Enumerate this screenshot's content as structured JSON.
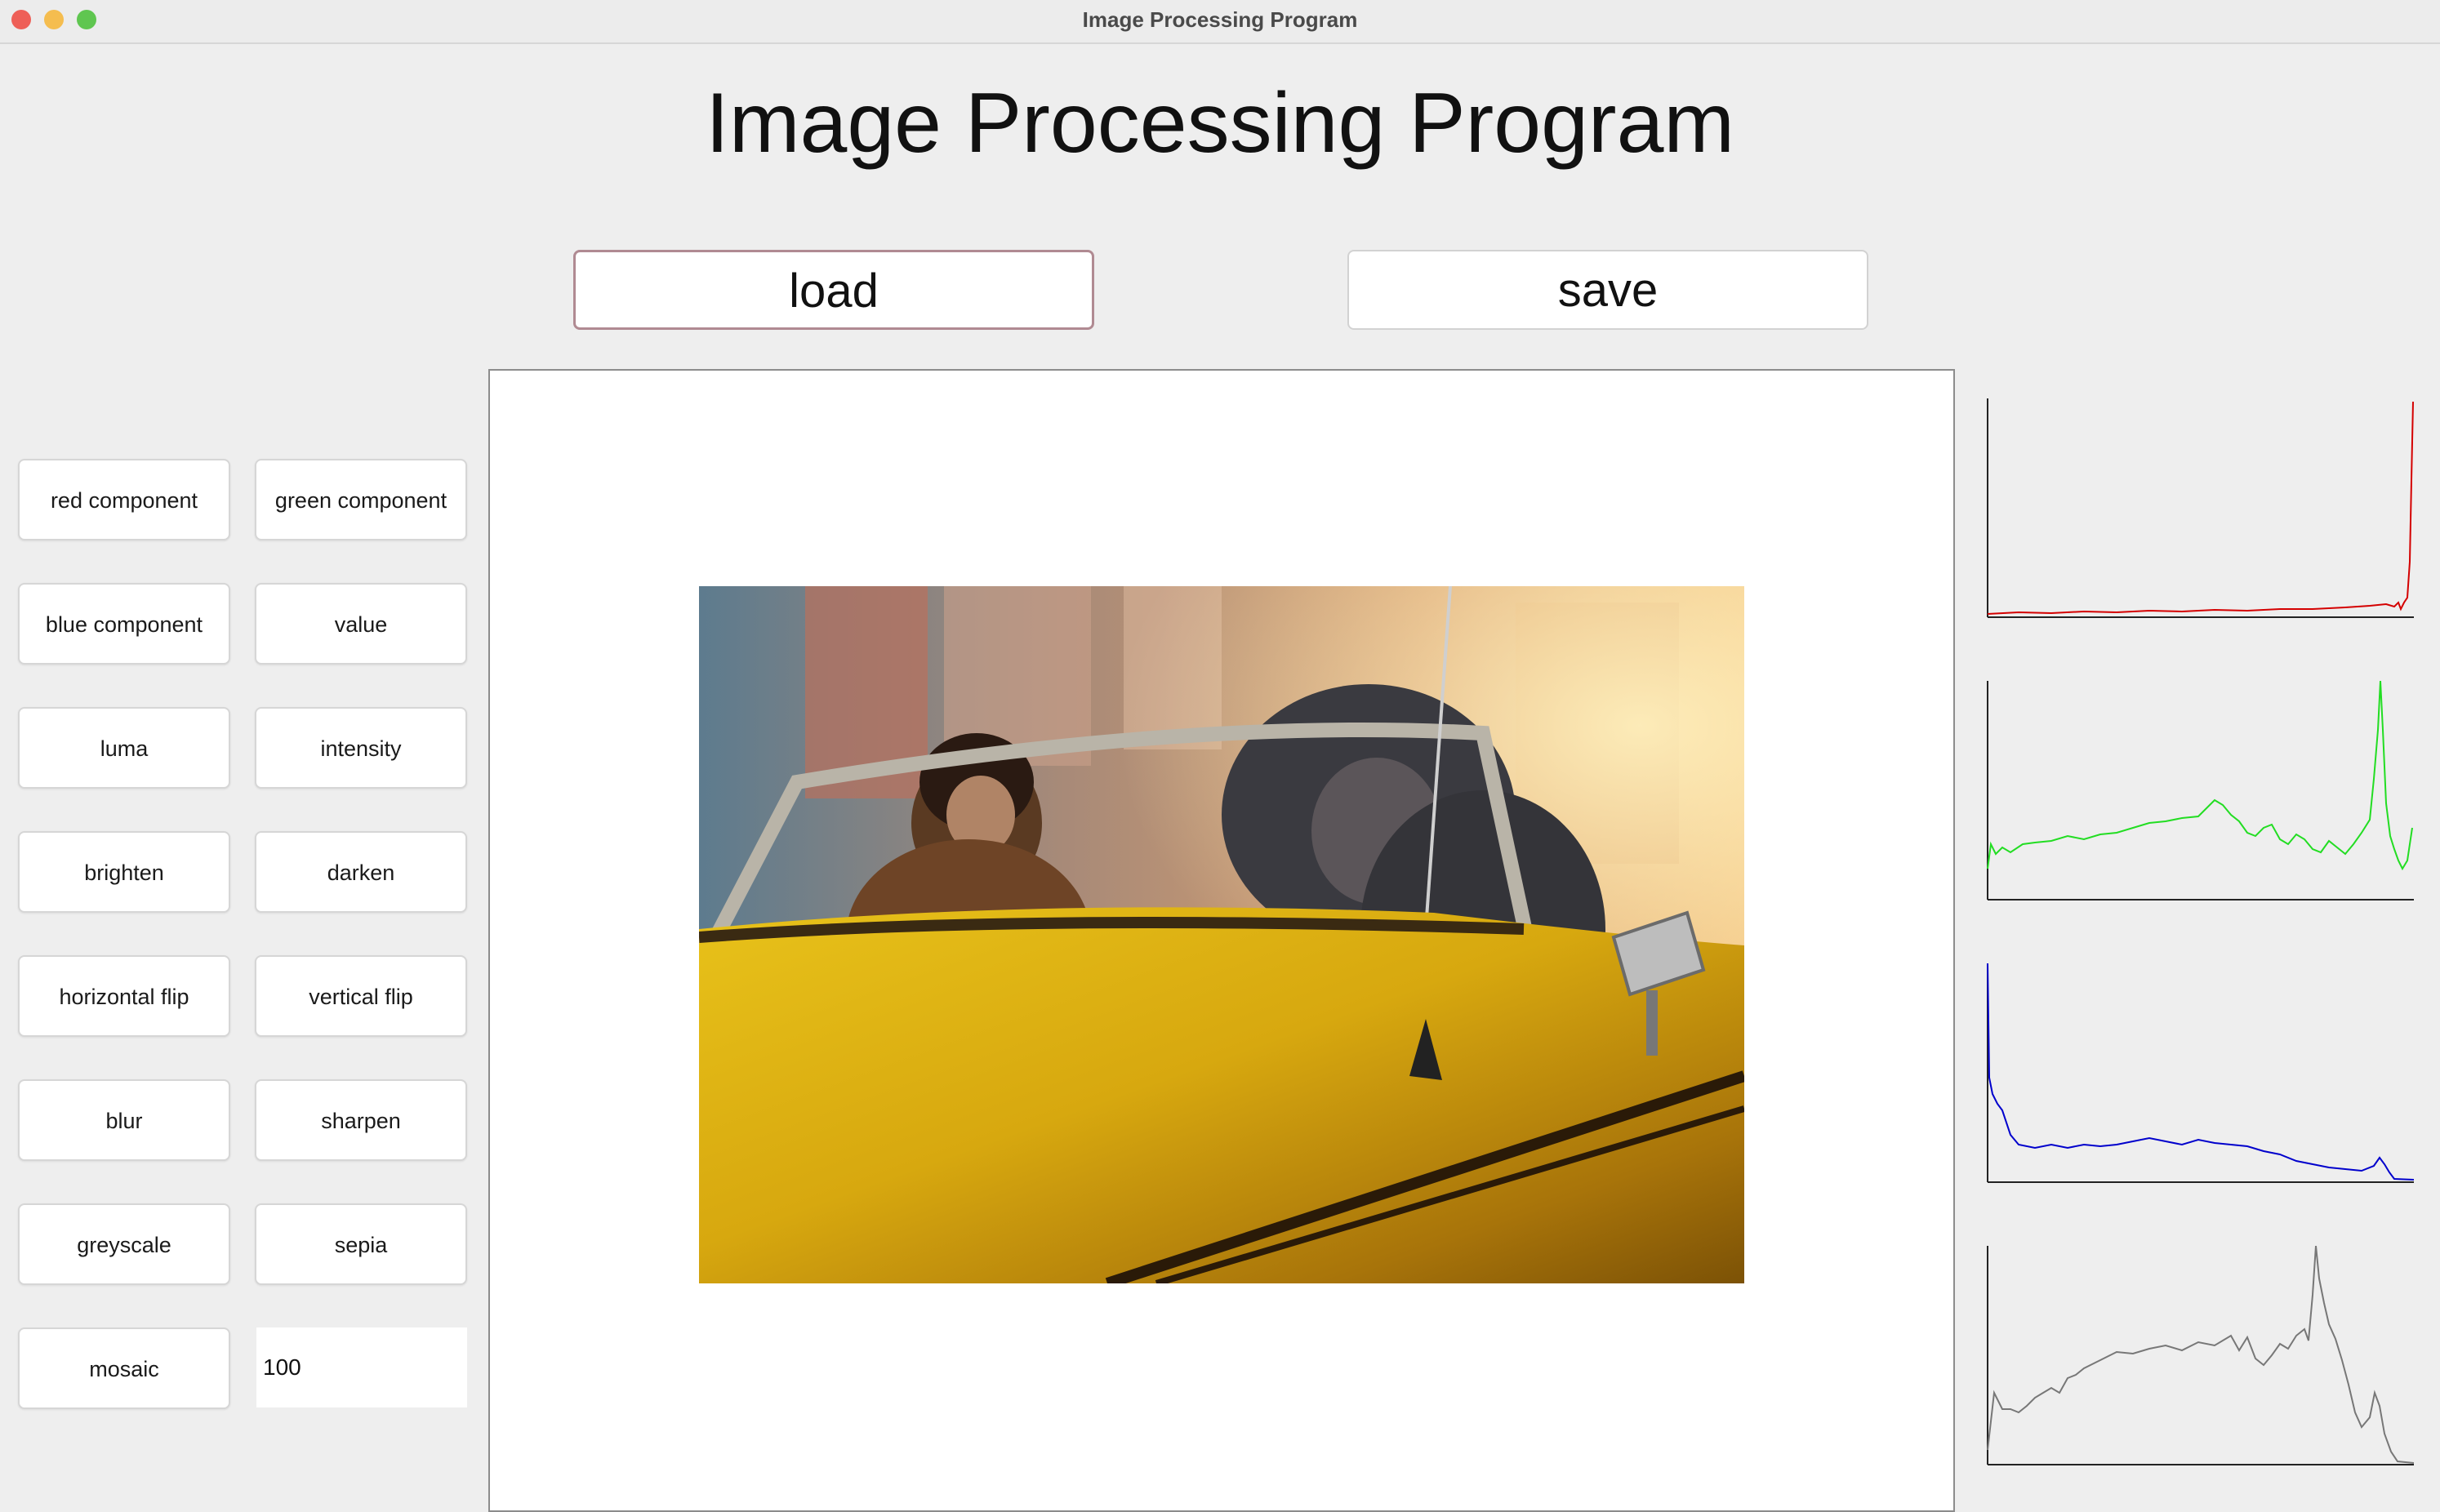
{
  "window": {
    "title": "Image Processing Program"
  },
  "header": {
    "heading": "Image Processing Program"
  },
  "toolbar": {
    "load_label": "load",
    "save_label": "save"
  },
  "operations": {
    "red_component": "red component",
    "green_component": "green component",
    "blue_component": "blue component",
    "value": "value",
    "luma": "luma",
    "intensity": "intensity",
    "brighten": "brighten",
    "darken": "darken",
    "horizontal_flip": "horizontal flip",
    "vertical_flip": "vertical flip",
    "blur": "blur",
    "sharpen": "sharpen",
    "greyscale": "greyscale",
    "sepia": "sepia",
    "mosaic": "mosaic"
  },
  "mosaic_seeds": {
    "value": "100"
  },
  "image_preview": {
    "description_icon": "photo-icon"
  },
  "histograms": {
    "colors": {
      "red": "#d40000",
      "green": "#22dd22",
      "blue": "#0000cc",
      "intensity": "#777777"
    }
  }
}
